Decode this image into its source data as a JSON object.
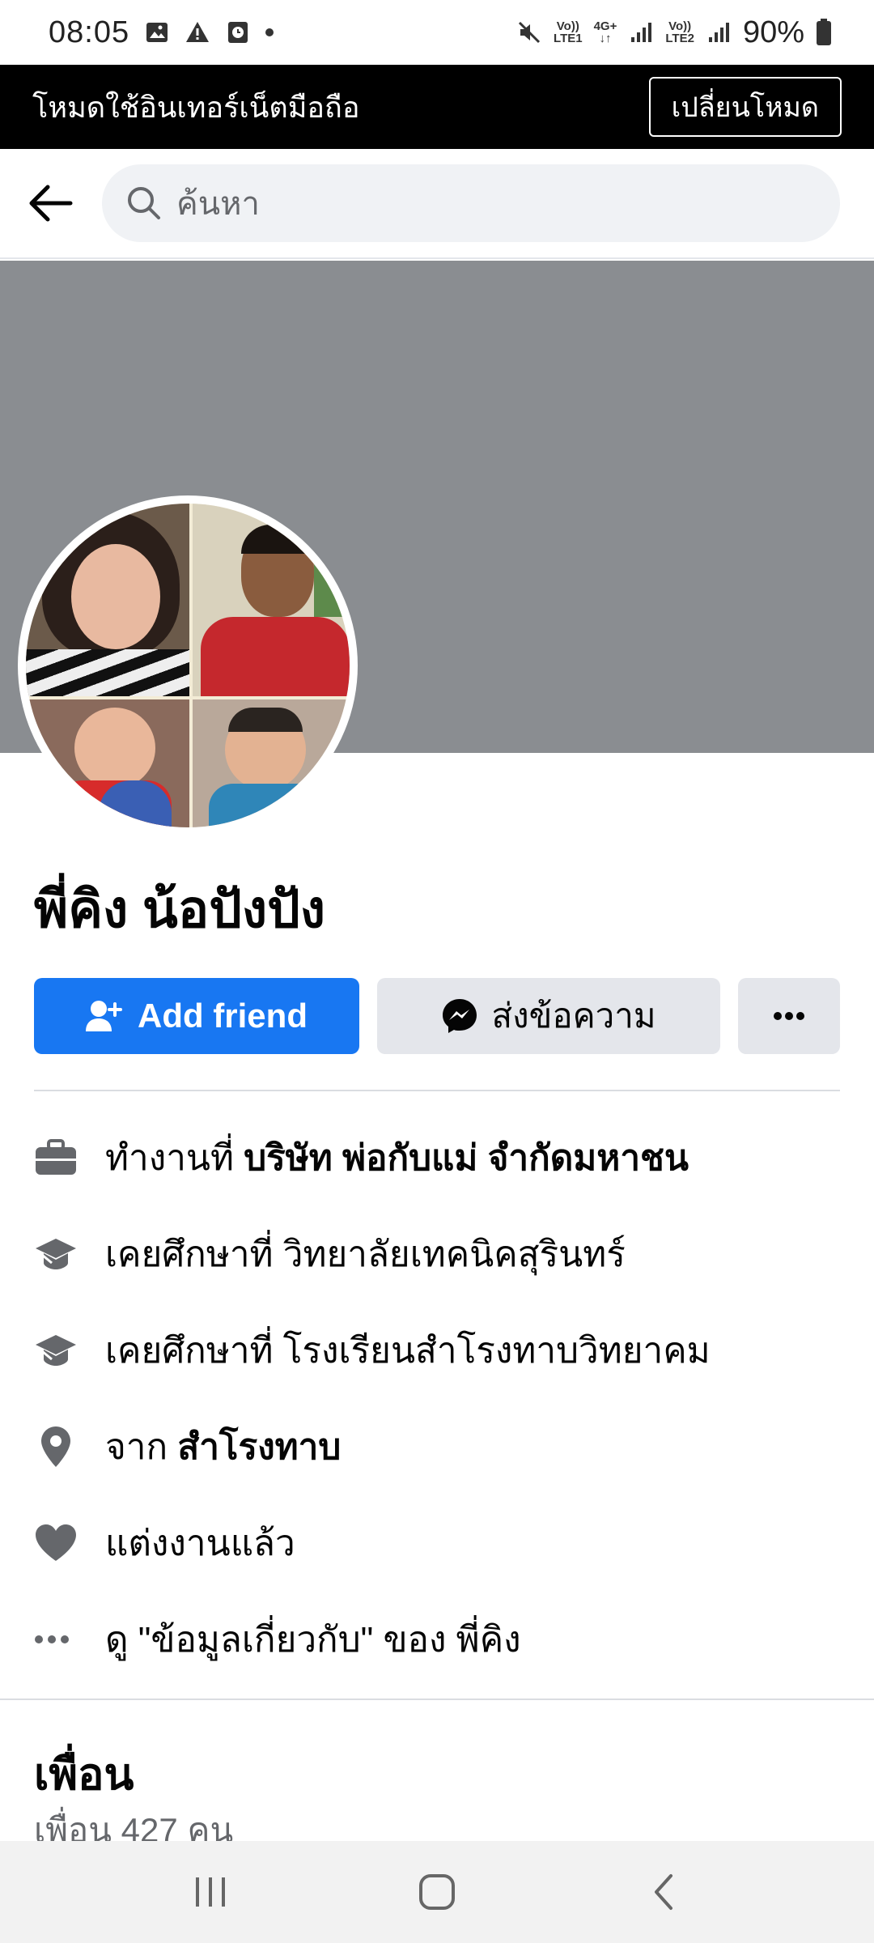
{
  "status_bar": {
    "time": "08:05",
    "sim1_label_top": "Vo))",
    "sim1_label_bottom": "LTE1",
    "net_label_top": "4G+",
    "sim2_label_top": "Vo))",
    "sim2_label_bottom": "LTE2",
    "battery": "90%"
  },
  "banner": {
    "label": "โหมดใช้อินเทอร์เน็ตมือถือ",
    "switch_button": "เปลี่ยนโหมด"
  },
  "search": {
    "placeholder": "ค้นหา"
  },
  "profile": {
    "name": "พี่คิง น้อปังปัง",
    "add_friend": "Add friend",
    "message": "ส่งข้อความ"
  },
  "details": {
    "work_prefix": "ทำงานที่ ",
    "work_place": "บริษัท พ่อกับแม่ จำกัดมหาชน",
    "edu1": "เคยศึกษาที่ วิทยาลัยเทคนิคสุรินทร์",
    "edu2": "เคยศึกษาที่ โรงเรียนสำโรงทาบวิทยาคม",
    "from_prefix": "จาก ",
    "from_place": "สำโรงทาบ",
    "relationship": "แต่งงานแล้ว",
    "see_about": "ดู \"ข้อมูลเกี่ยวกับ\" ของ พี่คิง"
  },
  "friends": {
    "title": "เพื่อน",
    "count": "เพื่อน 427 คน"
  },
  "colors": {
    "primary": "#1877f2",
    "cover": "#8a8d91",
    "secondary_button": "#e4e6eb"
  }
}
